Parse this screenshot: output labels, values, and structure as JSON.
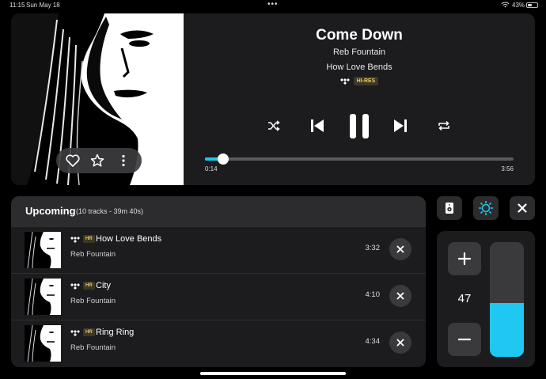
{
  "status_bar": {
    "time": "11:15",
    "date": "Sun May 18",
    "battery": "43%"
  },
  "now_playing": {
    "title": "Come Down",
    "artist": "Reb Fountain",
    "album": "How Love Bends",
    "quality_badge": "HI-RES",
    "elapsed": "0:14",
    "total": "3:56",
    "progress": 0.06
  },
  "queue": {
    "title": "Upcoming",
    "meta": "(10 tracks - 39m 40s)",
    "hr_label": "HR",
    "items": [
      {
        "title": "How Love Bends",
        "artist": "Reb Fountain",
        "duration": "3:32"
      },
      {
        "title": "City",
        "artist": "Reb Fountain",
        "duration": "4:10"
      },
      {
        "title": "Ring Ring",
        "artist": "Reb Fountain",
        "duration": "4:34"
      }
    ]
  },
  "volume": {
    "value": "47",
    "level": 0.47
  },
  "colors": {
    "accent": "#1ec8f0",
    "panel": "#1c1c1e",
    "badge_text": "#e8c860"
  }
}
